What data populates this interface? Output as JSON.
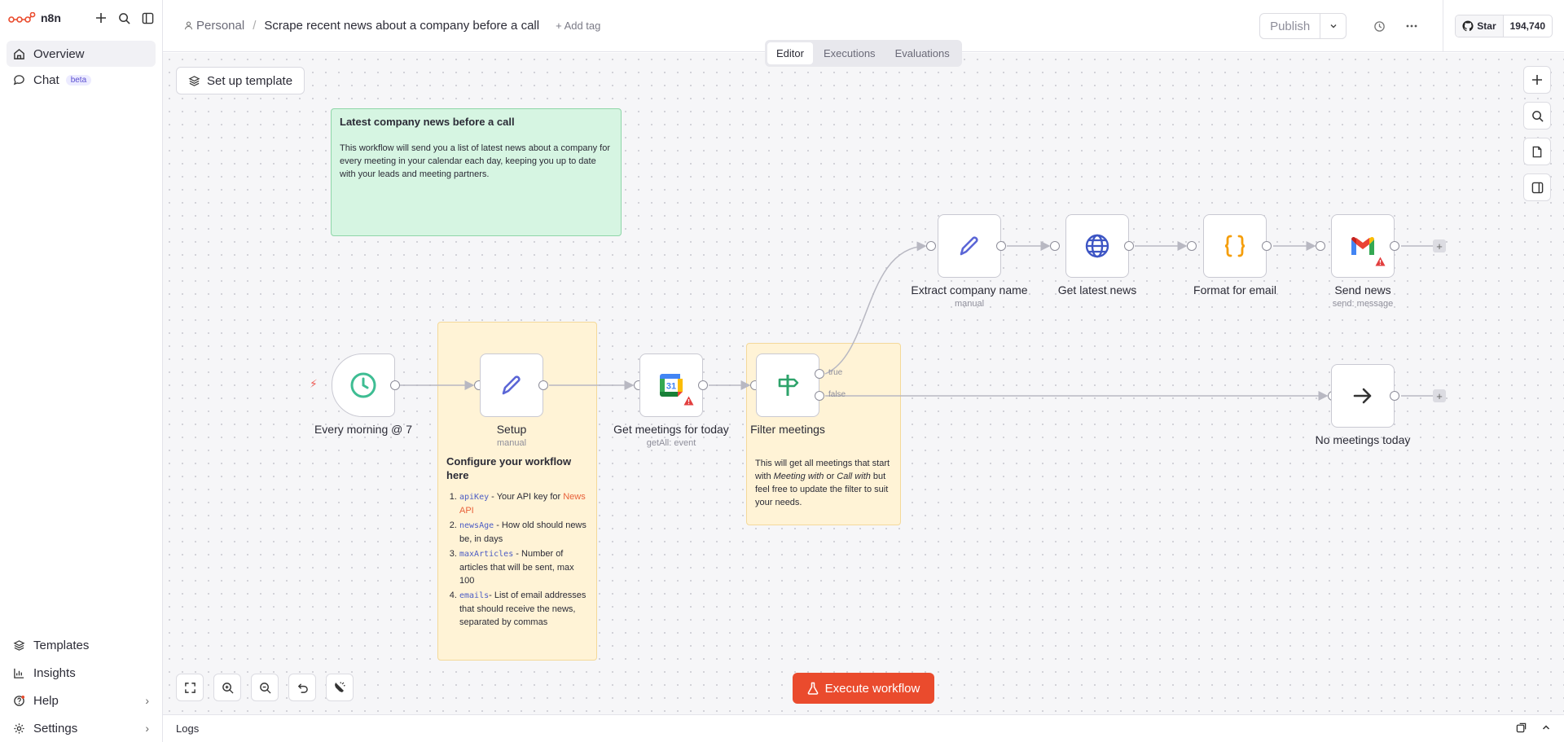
{
  "app": {
    "name": "n8n"
  },
  "sidebar": {
    "items": [
      {
        "label": "Overview"
      },
      {
        "label": "Chat",
        "badge": "beta"
      }
    ],
    "bottom": [
      {
        "label": "Templates"
      },
      {
        "label": "Insights"
      },
      {
        "label": "Help"
      },
      {
        "label": "Settings"
      }
    ]
  },
  "header": {
    "project": "Personal",
    "workflow_name": "Scrape recent news about a company before a call",
    "add_tag": "+ Add tag",
    "publish": "Publish",
    "github": {
      "star": "Star",
      "count": "194,740"
    }
  },
  "tabs": [
    "Editor",
    "Executions",
    "Evaluations"
  ],
  "canvas": {
    "setup_template": "Set up template",
    "execute": "Execute workflow",
    "sticky_green": {
      "title": "Latest company news before a call",
      "body": "This workflow will send you a list of latest news about a company for every meeting in your calendar each day, keeping you up to date with your leads and meeting partners."
    },
    "sticky_config": {
      "title": "Configure your workflow here",
      "items": [
        {
          "code": "apiKey",
          "text": " - Your API key for ",
          "link": "News API"
        },
        {
          "code": "newsAge",
          "text": " - How old should news be, in days"
        },
        {
          "code": "maxArticles",
          "text": " - Number of articles that will be sent, max 100"
        },
        {
          "code": "emails",
          "text": "- List of email addresses that should receive the news, separated by commas"
        }
      ]
    },
    "sticky_filter": {
      "p1": "This will get all meetings that start with ",
      "em1": "Meeting with",
      "p2": " or ",
      "em2": "Call with",
      "p3": " but feel free to update the filter to suit your needs."
    },
    "nodes": {
      "trigger": {
        "label": "Every morning @ 7"
      },
      "setup": {
        "label": "Setup",
        "sub": "manual"
      },
      "calendar": {
        "label": "Get meetings for today",
        "sub": "getAll: event",
        "badge": "31"
      },
      "filter": {
        "label": "Filter meetings",
        "true_label": "true",
        "false_label": "false"
      },
      "extract": {
        "label": "Extract company name",
        "sub": "manual"
      },
      "news": {
        "label": "Get latest news"
      },
      "format": {
        "label": "Format for email"
      },
      "send": {
        "label": "Send news",
        "sub": "send: message"
      },
      "nomeet": {
        "label": "No meetings today"
      }
    }
  },
  "logs": {
    "label": "Logs"
  },
  "colors": {
    "accent": "#ea4b2d",
    "sticky_green": "#d6f5e2",
    "sticky_yellow": "#fff3d6"
  }
}
